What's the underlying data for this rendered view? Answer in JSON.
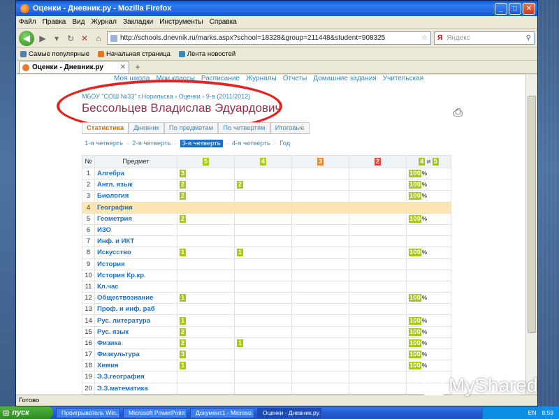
{
  "window": {
    "title": "Оценки - Дневник.ру - Mozilla Firefox"
  },
  "menu": [
    "Файл",
    "Правка",
    "Вид",
    "Журнал",
    "Закладки",
    "Инструменты",
    "Справка"
  ],
  "nav": {
    "back": "◀",
    "forward": "▶",
    "url": "http://schools.dnevnik.ru/marks.aspx?school=18328&group=211448&student=908325",
    "search_placeholder": "Яндекс",
    "search_logo": "Я"
  },
  "bookmarks": [
    "Самые популярные",
    "Начальная страница",
    "Лента новостей"
  ],
  "tab": {
    "label": "Оценки - Дневник.ру"
  },
  "site_nav": [
    "Моя школа",
    "Мои классы",
    "Расписание",
    "Журналы",
    "Отчеты",
    "Домашние задания",
    "Учительская"
  ],
  "breadcrumb": "МБОУ \"СОШ №33\" г.Норильска  ›  Оценки  ›  9-а (2011/2012)",
  "student_name": "Бессольцев Владислав Эдуардович",
  "page_tabs": [
    "Статистика",
    "Дневник",
    "По предметам",
    "По четвертям",
    "Итоговые"
  ],
  "active_page_tab": "Статистика",
  "quarters": [
    "1-я четверть",
    "2-я четверть",
    "3-я четверть",
    "4-я четверть",
    "Год"
  ],
  "active_quarter": "3-я четверть",
  "table": {
    "headers": {
      "num": "№",
      "subject": "Предмет",
      "g5": "5",
      "g4": "4",
      "g3": "3",
      "g2": "2",
      "pct_a": "4",
      "pct_and": "и",
      "pct_b": "5"
    },
    "rows": [
      {
        "n": "1",
        "s": "Алгебра",
        "c5": "3",
        "c4": "",
        "c3": "",
        "c2": "",
        "p": "100"
      },
      {
        "n": "2",
        "s": "Англ. язык",
        "c5": "2",
        "c4": "2",
        "c3": "",
        "c2": "",
        "p": "100"
      },
      {
        "n": "3",
        "s": "Биология",
        "c5": "2",
        "c4": "",
        "c3": "",
        "c2": "",
        "p": "100"
      },
      {
        "n": "4",
        "s": "География",
        "c5": "",
        "c4": "",
        "c3": "",
        "c2": "",
        "p": "",
        "hl": true
      },
      {
        "n": "5",
        "s": "Геометрия",
        "c5": "2",
        "c4": "",
        "c3": "",
        "c2": "",
        "p": "100"
      },
      {
        "n": "6",
        "s": "ИЗО",
        "c5": "",
        "c4": "",
        "c3": "",
        "c2": "",
        "p": ""
      },
      {
        "n": "7",
        "s": "Инф. и ИКТ",
        "c5": "",
        "c4": "",
        "c3": "",
        "c2": "",
        "p": ""
      },
      {
        "n": "8",
        "s": "Искусство",
        "c5": "1",
        "c4": "1",
        "c3": "",
        "c2": "",
        "p": "100"
      },
      {
        "n": "9",
        "s": "История",
        "c5": "",
        "c4": "",
        "c3": "",
        "c2": "",
        "p": ""
      },
      {
        "n": "10",
        "s": "История Кр.кр.",
        "c5": "",
        "c4": "",
        "c3": "",
        "c2": "",
        "p": ""
      },
      {
        "n": "11",
        "s": "Кл.час",
        "c5": "",
        "c4": "",
        "c3": "",
        "c2": "",
        "p": ""
      },
      {
        "n": "12",
        "s": "Обществознание",
        "c5": "1",
        "c4": "",
        "c3": "",
        "c2": "",
        "p": "100"
      },
      {
        "n": "13",
        "s": "Проф. и инф. раб",
        "c5": "",
        "c4": "",
        "c3": "",
        "c2": "",
        "p": ""
      },
      {
        "n": "14",
        "s": "Рус. литература",
        "c5": "1",
        "c4": "",
        "c3": "",
        "c2": "",
        "p": "100"
      },
      {
        "n": "15",
        "s": "Рус. язык",
        "c5": "2",
        "c4": "",
        "c3": "",
        "c2": "",
        "p": "100"
      },
      {
        "n": "16",
        "s": "Физика",
        "c5": "2",
        "c4": "1",
        "c3": "",
        "c2": "",
        "p": "100"
      },
      {
        "n": "17",
        "s": "Физкультура",
        "c5": "3",
        "c4": "",
        "c3": "",
        "c2": "",
        "p": "100"
      },
      {
        "n": "18",
        "s": "Химия",
        "c5": "1",
        "c4": "",
        "c3": "",
        "c2": "",
        "p": "100"
      },
      {
        "n": "19",
        "s": "Э.З.география",
        "c5": "",
        "c4": "",
        "c3": "",
        "c2": "",
        "p": ""
      },
      {
        "n": "20",
        "s": "Э.З.математика",
        "c5": "",
        "c4": "",
        "c3": "",
        "c2": "",
        "p": ""
      }
    ],
    "pct_suffix": "%"
  },
  "status": "Готово",
  "taskbar": {
    "start": "пуск",
    "items": [
      "Проигрыватель Win...",
      "Microsoft PowerPoint ...",
      "Документ1 - Microso...",
      "Оценки - Дневник.ру..."
    ],
    "lang": "EN",
    "time": "8:59"
  },
  "watermark": "MyShared",
  "colors": {
    "accent_link": "#3a8ac0",
    "student_name": "#9a2c4a",
    "grade_5": "#a7c817",
    "grade_3": "#eb8a2d",
    "grade_2": "#d84b3b",
    "highlight_row": "#fbe6b4",
    "annotation_ring": "#e52222"
  }
}
